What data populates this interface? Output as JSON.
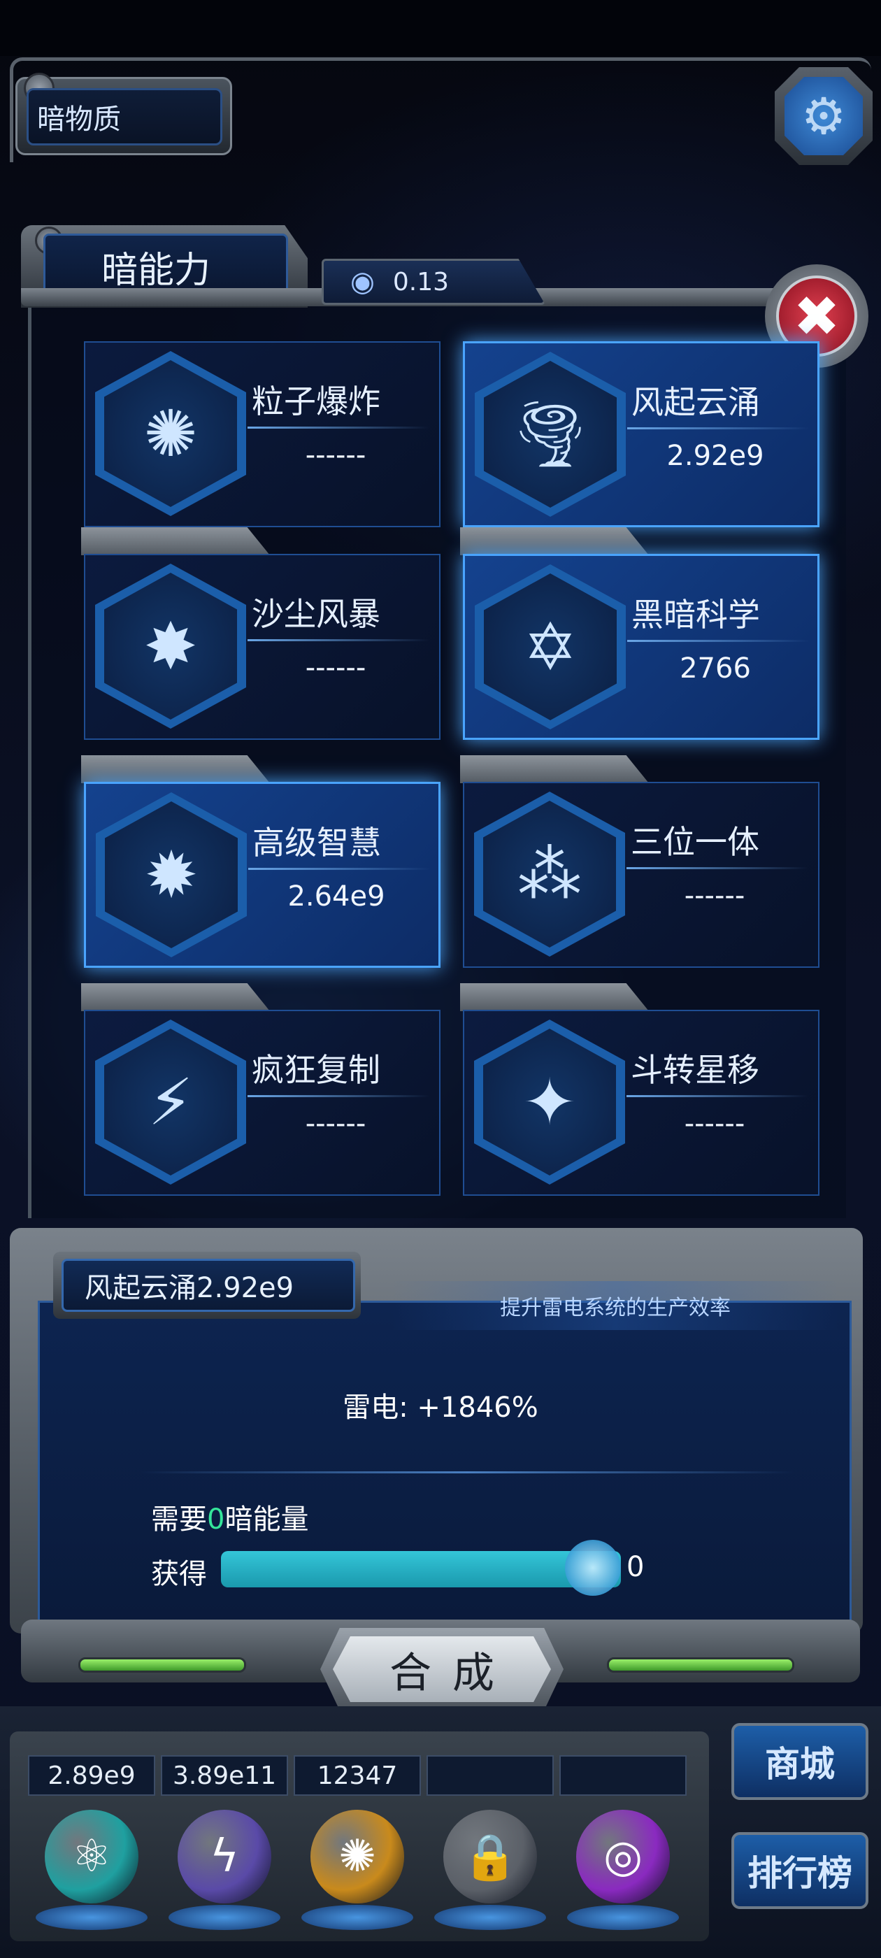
{
  "resource": {
    "label": "暗物质"
  },
  "settings": {
    "icon": "gear-icon",
    "glyph": "⚙"
  },
  "panel": {
    "title": "暗能力",
    "energy_value": "0.13",
    "energy_icon": "galaxy-icon",
    "close_icon": "close-icon",
    "close_glyph": "✖"
  },
  "abilities": [
    {
      "name": "粒子爆炸",
      "value": "------",
      "icon": "explosion-icon",
      "glyph": "✺",
      "active": false
    },
    {
      "name": "风起云涌",
      "value": "2.92e9",
      "icon": "tornado-icon",
      "glyph": "🌪",
      "active": true
    },
    {
      "name": "沙尘风暴",
      "value": "------",
      "icon": "sandstorm-icon",
      "glyph": "✸",
      "active": false
    },
    {
      "name": "黑暗科学",
      "value": "2766",
      "icon": "hexagram-icon",
      "glyph": "✡",
      "active": true
    },
    {
      "name": "高级智慧",
      "value": "2.64e9",
      "icon": "brain-icon",
      "glyph": "✹",
      "active": true
    },
    {
      "name": "三位一体",
      "value": "------",
      "icon": "trinity-icon",
      "glyph": "⁂",
      "active": false
    },
    {
      "name": "疯狂复制",
      "value": "------",
      "icon": "lightning-icon",
      "glyph": "⚡",
      "active": false
    },
    {
      "name": "斗转星移",
      "value": "------",
      "icon": "swirl-icon",
      "glyph": "✦",
      "active": false
    }
  ],
  "detail": {
    "title": "风起云涌2.92e9",
    "description": "提升雷电系统的生产效率",
    "stat": "雷电: +1846%",
    "need_prefix": "需要",
    "need_amount": "0",
    "need_suffix": "暗能量",
    "gain_label": "获得",
    "gain_value": "0",
    "gain_progress": 1.0,
    "combine_label": "合成"
  },
  "dock": {
    "slots": [
      "2.89e9",
      "3.89e11",
      "12347",
      "",
      ""
    ],
    "orbs": [
      {
        "icon": "atom-orb-icon",
        "glyph": "⚛",
        "color": "#1fa0a0"
      },
      {
        "icon": "thunder-orb-icon",
        "glyph": "ϟ",
        "color": "#5a4aa8"
      },
      {
        "icon": "fire-orb-icon",
        "glyph": "✺",
        "color": "#c98a1c"
      },
      {
        "icon": "lock-icon",
        "glyph": "🔒",
        "color": "#5b6068"
      },
      {
        "icon": "vortex-orb-icon",
        "glyph": "◎",
        "color": "#8a2ac0"
      }
    ],
    "shop_label": "商城",
    "rank_label": "排行榜"
  }
}
